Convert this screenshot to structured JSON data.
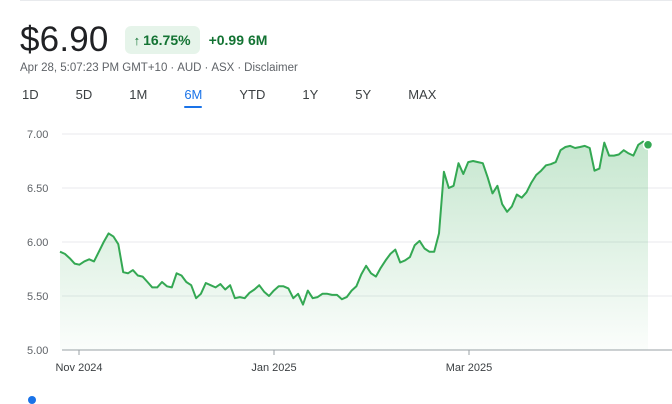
{
  "quote": {
    "price": "$6.90",
    "pct_change": "16.75%",
    "change": "+0.99",
    "period": "6M",
    "colors": {
      "up": "#137333",
      "up_bg": "#e6f4ea",
      "line": "#34a853"
    }
  },
  "meta": {
    "timestamp": "Apr 28, 5:07:23 PM GMT+10",
    "currency": "AUD",
    "exchange": "ASX",
    "disclaimer": "Disclaimer"
  },
  "ranges": [
    "1D",
    "5D",
    "1M",
    "6M",
    "YTD",
    "1Y",
    "5Y",
    "MAX"
  ],
  "selected_range": "6M",
  "chart_data": {
    "type": "area",
    "ylim": [
      5.0,
      7.0
    ],
    "yticks": [
      "7.00",
      "6.50",
      "6.00",
      "5.50",
      "5.00"
    ],
    "xticks": [
      "Nov 2024",
      "Jan 2025",
      "Mar 2025"
    ],
    "values": [
      5.91,
      5.89,
      5.85,
      5.8,
      5.79,
      5.82,
      5.84,
      5.82,
      5.91,
      6.0,
      6.08,
      6.05,
      5.98,
      5.72,
      5.71,
      5.74,
      5.69,
      5.68,
      5.63,
      5.58,
      5.58,
      5.63,
      5.59,
      5.58,
      5.71,
      5.69,
      5.63,
      5.6,
      5.48,
      5.52,
      5.62,
      5.6,
      5.58,
      5.61,
      5.56,
      5.6,
      5.48,
      5.49,
      5.48,
      5.53,
      5.56,
      5.6,
      5.54,
      5.5,
      5.55,
      5.59,
      5.59,
      5.57,
      5.48,
      5.52,
      5.42,
      5.55,
      5.48,
      5.49,
      5.52,
      5.52,
      5.51,
      5.51,
      5.47,
      5.49,
      5.55,
      5.59,
      5.7,
      5.78,
      5.71,
      5.68,
      5.76,
      5.83,
      5.89,
      5.93,
      5.81,
      5.83,
      5.86,
      5.97,
      6.01,
      5.94,
      5.91,
      5.91,
      6.08,
      6.65,
      6.5,
      6.52,
      6.73,
      6.63,
      6.74,
      6.75,
      6.74,
      6.73,
      6.6,
      6.45,
      6.52,
      6.35,
      6.28,
      6.33,
      6.44,
      6.41,
      6.46,
      6.55,
      6.62,
      6.66,
      6.71,
      6.72,
      6.74,
      6.85,
      6.88,
      6.89,
      6.87,
      6.88,
      6.89,
      6.87,
      6.66,
      6.68,
      6.92,
      6.8,
      6.8,
      6.81,
      6.85,
      6.82,
      6.8,
      6.9,
      6.93,
      6.9
    ]
  }
}
